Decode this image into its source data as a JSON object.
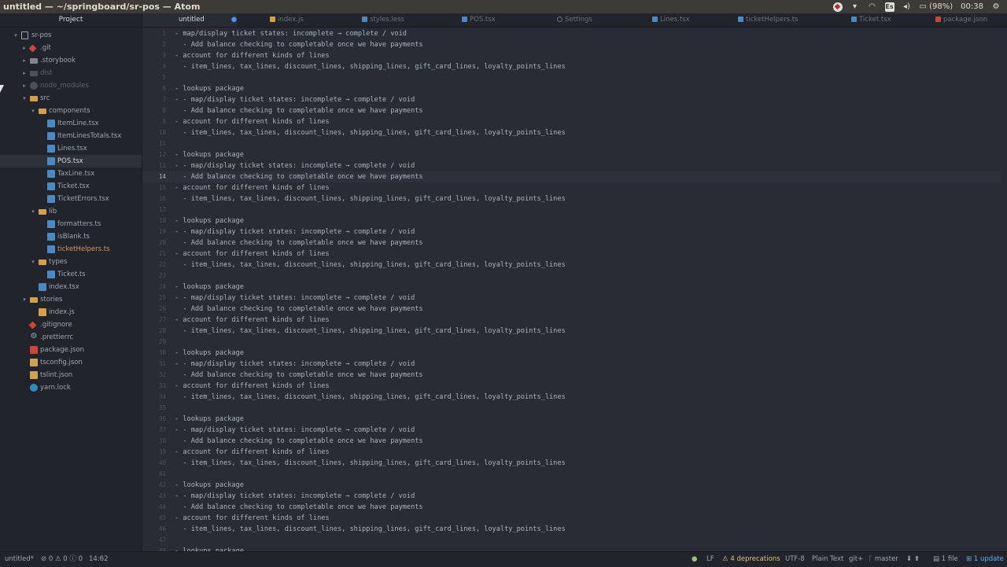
{
  "window": {
    "title": "untitled — ~/springboard/sr-pos — Atom"
  },
  "tray": {
    "battery": "(98%)",
    "keyboard": "Es",
    "time": "00:38"
  },
  "tree": {
    "header": "Project",
    "items": [
      {
        "label": "sr-pos",
        "icon": "repo-icon",
        "expanded": true
      },
      {
        "label": ".git",
        "icon": "git-icon",
        "expanded": false
      },
      {
        "label": ".storybook",
        "icon": "folder-icon",
        "expanded": false
      },
      {
        "label": "dist",
        "icon": "folder-icon",
        "expanded": false
      },
      {
        "label": "node_modules",
        "icon": "package-icon",
        "expanded": false
      },
      {
        "label": "src",
        "icon": "folder-open-icon",
        "expanded": true
      },
      {
        "label": "components",
        "icon": "folder-open-icon",
        "expanded": true
      },
      {
        "label": "ItemLine.tsx",
        "icon": "typescript-file-icon"
      },
      {
        "label": "ItemLinesTotals.tsx",
        "icon": "typescript-file-icon"
      },
      {
        "label": "Lines.tsx",
        "icon": "typescript-file-icon"
      },
      {
        "label": "POS.tsx",
        "icon": "typescript-file-icon",
        "selected": true
      },
      {
        "label": "TaxLine.tsx",
        "icon": "typescript-file-icon"
      },
      {
        "label": "Ticket.tsx",
        "icon": "typescript-file-icon"
      },
      {
        "label": "TicketErrors.tsx",
        "icon": "typescript-file-icon"
      },
      {
        "label": "lib",
        "icon": "folder-open-icon",
        "expanded": true
      },
      {
        "label": "formatters.ts",
        "icon": "typescript-file-icon"
      },
      {
        "label": "isBlank.ts",
        "icon": "typescript-file-icon"
      },
      {
        "label": "ticketHelpers.ts",
        "icon": "typescript-file-icon",
        "modified": true
      },
      {
        "label": "types",
        "icon": "folder-open-icon",
        "expanded": true
      },
      {
        "label": "Ticket.ts",
        "icon": "typescript-file-icon"
      },
      {
        "label": "index.tsx",
        "icon": "typescript-file-icon"
      },
      {
        "label": "stories",
        "icon": "folder-open-icon",
        "expanded": true
      },
      {
        "label": "index.js",
        "icon": "javascript-file-icon"
      },
      {
        "label": ".gitignore",
        "icon": "git-icon"
      },
      {
        "label": ".prettierrc",
        "icon": "gear-icon"
      },
      {
        "label": "package.json",
        "icon": "npm-icon"
      },
      {
        "label": "tsconfig.json",
        "icon": "json-file-icon"
      },
      {
        "label": "tslint.json",
        "icon": "json-file-icon"
      },
      {
        "label": "yarn.lock",
        "icon": "yarn-icon"
      }
    ]
  },
  "tabs": [
    {
      "label": "untitled",
      "icon": "",
      "active": true,
      "modified": true
    },
    {
      "label": "index.js",
      "icon": "javascript-file-icon"
    },
    {
      "label": "styles.less",
      "icon": "less-file-icon"
    },
    {
      "label": "POS.tsx",
      "icon": "typescript-file-icon"
    },
    {
      "label": "Settings",
      "icon": "gear-icon"
    },
    {
      "label": "Lines.tsx",
      "icon": "typescript-file-icon"
    },
    {
      "label": "ticketHelpers.ts",
      "icon": "typescript-file-icon"
    },
    {
      "label": "Ticket.tsx",
      "icon": "typescript-file-icon"
    },
    {
      "label": "package.json",
      "icon": "npm-icon"
    }
  ],
  "editor": {
    "current_line": 14,
    "lines": [
      "- map/display ticket states: incomplete → complete / void",
      "  - Add balance checking to completable once we have payments",
      "- account for different kinds of lines",
      "  - item_lines, tax_lines, discount_lines, shipping_lines, gift_card_lines, loyalty_points_lines",
      "",
      "- lookups package",
      "- - map/display ticket states: incomplete → complete / void",
      "  - Add balance checking to completable once we have payments",
      "- account for different kinds of lines",
      "  - item_lines, tax_lines, discount_lines, shipping_lines, gift_card_lines, loyalty_points_lines",
      "",
      "- lookups package",
      "- - map/display ticket states: incomplete → complete / void",
      "  - Add balance checking to completable once we have payments",
      "- account for different kinds of lines",
      "  - item_lines, tax_lines, discount_lines, shipping_lines, gift_card_lines, loyalty_points_lines",
      "",
      "- lookups package",
      "- - map/display ticket states: incomplete → complete / void",
      "  - Add balance checking to completable once we have payments",
      "- account for different kinds of lines",
      "  - item_lines, tax_lines, discount_lines, shipping_lines, gift_card_lines, loyalty_points_lines",
      "",
      "- lookups package",
      "- - map/display ticket states: incomplete → complete / void",
      "  - Add balance checking to completable once we have payments",
      "- account for different kinds of lines",
      "  - item_lines, tax_lines, discount_lines, shipping_lines, gift_card_lines, loyalty_points_lines",
      "",
      "- lookups package",
      "- - map/display ticket states: incomplete → complete / void",
      "  - Add balance checking to completable once we have payments",
      "- account for different kinds of lines",
      "  - item_lines, tax_lines, discount_lines, shipping_lines, gift_card_lines, loyalty_points_lines",
      "",
      "- lookups package",
      "- - map/display ticket states: incomplete → complete / void",
      "  - Add balance checking to completable once we have payments",
      "- account for different kinds of lines",
      "  - item_lines, tax_lines, discount_lines, shipping_lines, gift_card_lines, loyalty_points_lines",
      "",
      "- lookups package",
      "- - map/display ticket states: incomplete → complete / void",
      "  - Add balance checking to completable once we have payments",
      "- account for different kinds of lines",
      "  - item_lines, tax_lines, discount_lines, shipping_lines, gift_card_lines, loyalty_points_lines",
      "",
      "- lookups package"
    ]
  },
  "status": {
    "file": "untitled*",
    "errors": "0",
    "warnings": "0",
    "infos": "0",
    "cursor": "14:62",
    "line_ending": "LF",
    "deprecations": "4 deprecations",
    "encoding": "UTF-8",
    "grammar": "Plain Text",
    "git": "git+",
    "branch": "master",
    "files": "1 file",
    "update": "1 update"
  }
}
